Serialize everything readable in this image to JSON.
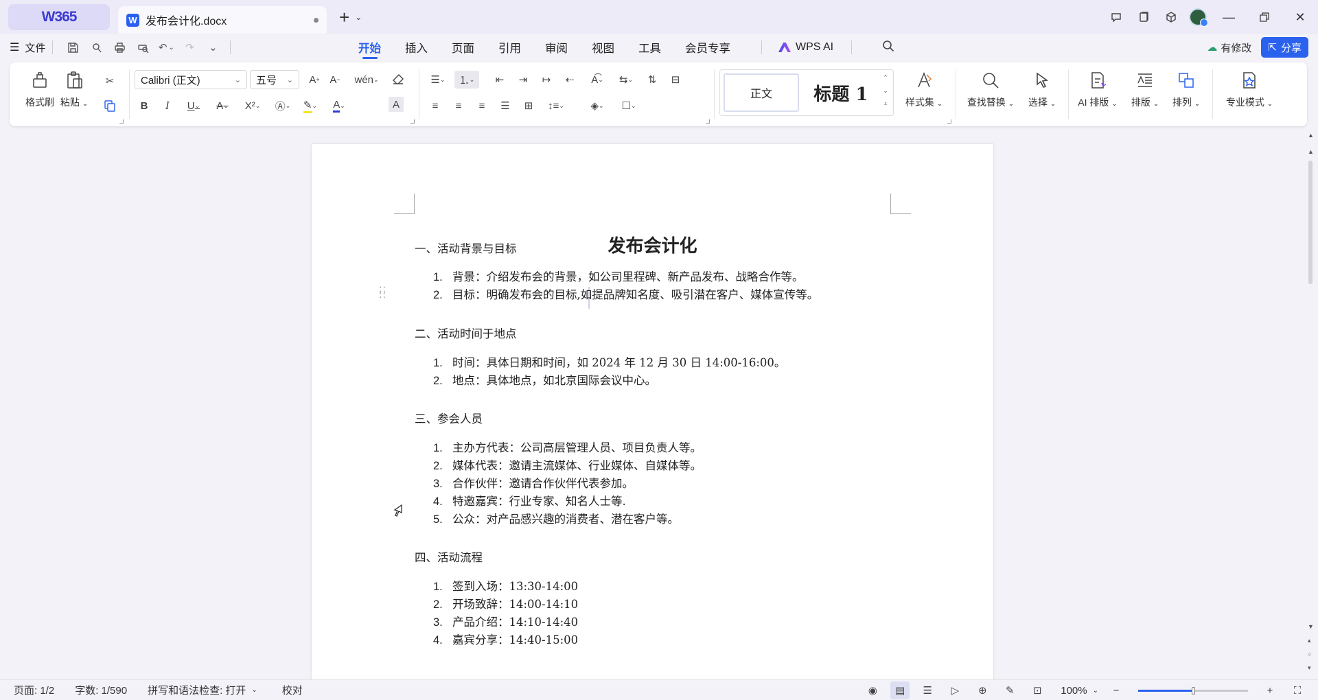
{
  "app": {
    "brand": "W365",
    "doc_tab": "发布会计化.docx"
  },
  "menu": {
    "file": "文件",
    "tabs": [
      "开始",
      "插入",
      "页面",
      "引用",
      "审阅",
      "视图",
      "工具",
      "会员专享"
    ],
    "active_tab": "开始",
    "wps_ai": "WPS AI",
    "changes": "有修改",
    "share": "分享"
  },
  "ribbon": {
    "format_painter": "格式刷",
    "paste": "粘贴",
    "font_name": "Calibri (正文)",
    "font_size": "五号",
    "style_normal": "正文",
    "style_heading": "标题 1",
    "style_set": "样式集",
    "find_replace": "查找替换",
    "select": "选择",
    "ai_layout": "AI 排版",
    "layout": "排版",
    "arrange": "排列",
    "pro_mode": "专业模式"
  },
  "document": {
    "title": "发布会计化",
    "sections": [
      {
        "heading": "一、活动背景与目标",
        "items": [
          "背景：介绍发布会的背景，如公司里程碑、新产品发布、战略合作等。",
          "目标：明确发布会的目标,如提品牌知名度、吸引潜在客户、媒体宣传等。"
        ]
      },
      {
        "heading": "二、活动时间于地点",
        "items": [
          "时间：具体日期和时间，如 2024 年 12 月 30 日  14:00-16:00。",
          "地点：具体地点，如北京国际会议中心。"
        ]
      },
      {
        "heading": "三、参会人员",
        "items": [
          "主办方代表：公司高层管理人员、项目负责人等。",
          "媒体代表：邀请主流媒体、行业媒体、自媒体等。",
          "合作伙伴：邀请合作伙伴代表参加。",
          "特邀嘉宾：行业专家、知名人士等.",
          "公众：对产品感兴趣的消费者、潜在客户等。"
        ]
      },
      {
        "heading": "四、活动流程",
        "items": [
          "签到入场：13:30-14:00",
          "开场致辞：14:00-14:10",
          "产品介绍：14:10-14:40",
          "嘉宾分享：14:40-15:00"
        ]
      }
    ]
  },
  "status": {
    "page": "页面: 1/2",
    "words": "字数: 1/590",
    "spell_check": "拼写和语法检查: 打开",
    "proofread": "校对",
    "zoom": "100%",
    "zoom_level": 0.5
  },
  "colors": {
    "accent": "#2a62ee",
    "brand": "#3b3bd1"
  }
}
